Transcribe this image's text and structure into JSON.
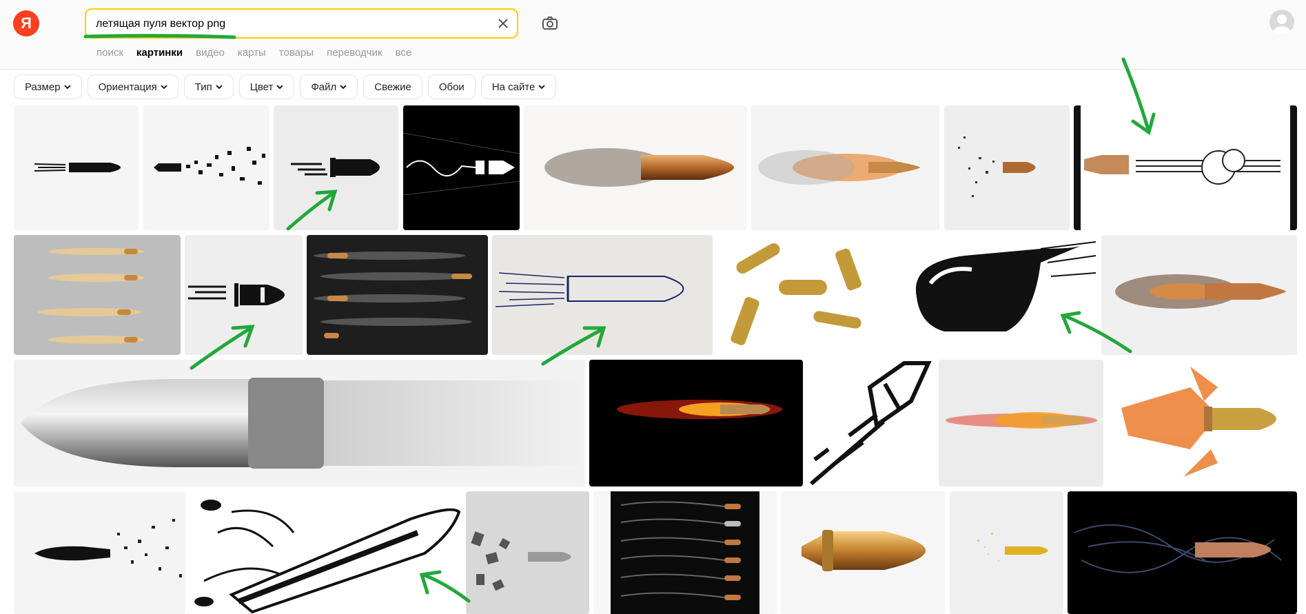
{
  "header": {
    "logo_letter": "Я",
    "search": {
      "query": "летящая пуля вектор png"
    }
  },
  "tabs": [
    {
      "label": "поиск",
      "active": false
    },
    {
      "label": "картинки",
      "active": true
    },
    {
      "label": "видео",
      "active": false
    },
    {
      "label": "карты",
      "active": false
    },
    {
      "label": "товары",
      "active": false
    },
    {
      "label": "переводчик",
      "active": false
    },
    {
      "label": "все",
      "active": false
    }
  ],
  "filters": [
    {
      "label": "Размер",
      "dropdown": true
    },
    {
      "label": "Ориентация",
      "dropdown": true
    },
    {
      "label": "Тип",
      "dropdown": true
    },
    {
      "label": "Цвет",
      "dropdown": true
    },
    {
      "label": "Файл",
      "dropdown": true
    },
    {
      "label": "Свежие",
      "dropdown": false
    },
    {
      "label": "Обои",
      "dropdown": false
    },
    {
      "label": "На сайте",
      "dropdown": true
    }
  ],
  "colors": {
    "accent": "#ffcc00",
    "brand": "#fc3f1d",
    "annotation": "#22a83a"
  }
}
